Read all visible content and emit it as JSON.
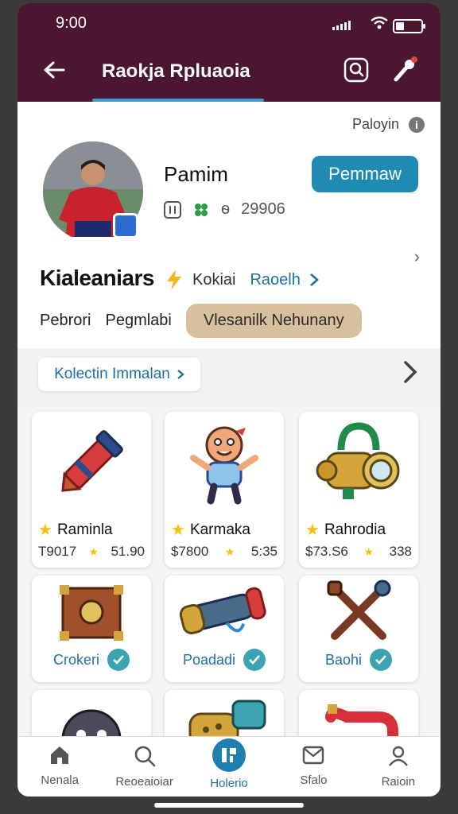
{
  "status": {
    "time": "9:00"
  },
  "header": {
    "title": "Raokja Rpluaoia"
  },
  "profile": {
    "hint": "Paloyin",
    "name": "Pamim",
    "follow_label": "Pemmaw",
    "stat_a": "ѳ",
    "stat_count": "29906"
  },
  "section": {
    "title": "Kialeaniars",
    "tag": "Kokiai",
    "link": "Raoelh",
    "filters": [
      "Pebrori",
      "Pegmlabi"
    ],
    "active_filter": "Vlesanilk Nehunany"
  },
  "collection": {
    "label": "Kolectin Immalan"
  },
  "tiles": [
    {
      "name": "Raminla",
      "price": "T9017",
      "rating": "51.90"
    },
    {
      "name": "Karmaka",
      "price": "$7800",
      "rating": "5:35"
    },
    {
      "name": "Rahrodia",
      "price": "$73.S6",
      "rating": "338"
    }
  ],
  "tiles_row2": [
    {
      "label": "Crokeri"
    },
    {
      "label": "Poadadi"
    },
    {
      "label": "Baohi"
    }
  ],
  "tabs": [
    {
      "label": "Nenala"
    },
    {
      "label": "Reoeaioiar"
    },
    {
      "label": "Holerio"
    },
    {
      "label": "Sfalo"
    },
    {
      "label": "Raioin"
    }
  ],
  "colors": {
    "header_bg": "#4a1630",
    "accent": "#1f8ab2",
    "pill": "#d6c09e"
  }
}
